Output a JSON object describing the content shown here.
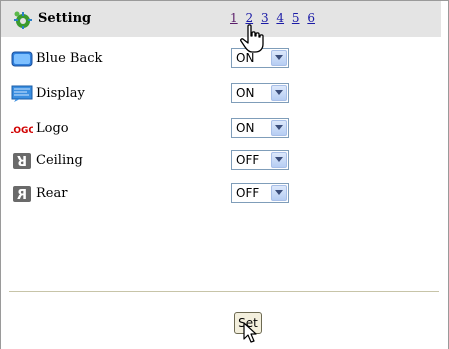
{
  "header": {
    "title": "Setting",
    "icon": "settings-gear-icon",
    "pages": [
      "1",
      "2",
      "3",
      "4",
      "5",
      "6"
    ],
    "current_page": "1"
  },
  "rows": [
    {
      "label": "Blue Back",
      "value": "ON",
      "icon": "blue-screen-icon"
    },
    {
      "label": "Display",
      "value": "ON",
      "icon": "display-icon"
    },
    {
      "label": "Logo",
      "value": "ON",
      "icon": "logo-icon",
      "icon_text": "LOGO"
    },
    {
      "label": "Ceiling",
      "value": "OFF",
      "icon": "ceiling-icon",
      "icon_text": "R"
    },
    {
      "label": "Rear",
      "value": "OFF",
      "icon": "rear-icon",
      "icon_text": "R"
    }
  ],
  "footer": {
    "set_label": "Set"
  },
  "colors": {
    "header_bg": "#e4e4e4",
    "link": "#1a1aa6",
    "select_border": "#7f9db9",
    "button_bg": "#f3efdd"
  }
}
